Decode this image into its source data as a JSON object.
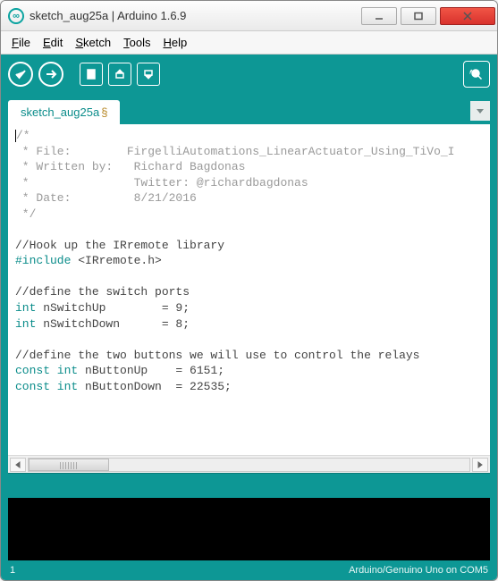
{
  "window": {
    "title": "sketch_aug25a | Arduino 1.6.9"
  },
  "menu": {
    "file": "File",
    "edit": "Edit",
    "sketch": "Sketch",
    "tools": "Tools",
    "help": "Help"
  },
  "tabs": {
    "active": "sketch_aug25a",
    "dirty": "§"
  },
  "code": {
    "l1": "/*",
    "l2a": " * File:        ",
    "l2b": "FirgelliAutomations_LinearActuator_Using_TiVo_I",
    "l3": " * Written by:   Richard Bagdonas",
    "l4": " *               Twitter: @richardbagdonas",
    "l5": " * Date:         8/21/2016",
    "l6": " */",
    "l8": "//Hook up the IRremote library",
    "l9a": "#include",
    "l9b": " <IRremote.h>",
    "l11": "//define the switch ports",
    "l12a": "int",
    "l12b": " nSwitchUp        = 9;",
    "l13a": "int",
    "l13b": " nSwitchDown      = 8;",
    "l15": "//define the two buttons we will use to control the relays",
    "l16a": "const int",
    "l16b": " nButtonUp    = 6151;",
    "l17a": "const int",
    "l17b": " nButtonDown  = 22535;"
  },
  "status": {
    "line": "1",
    "board": "Arduino/Genuino Uno on COM5"
  }
}
